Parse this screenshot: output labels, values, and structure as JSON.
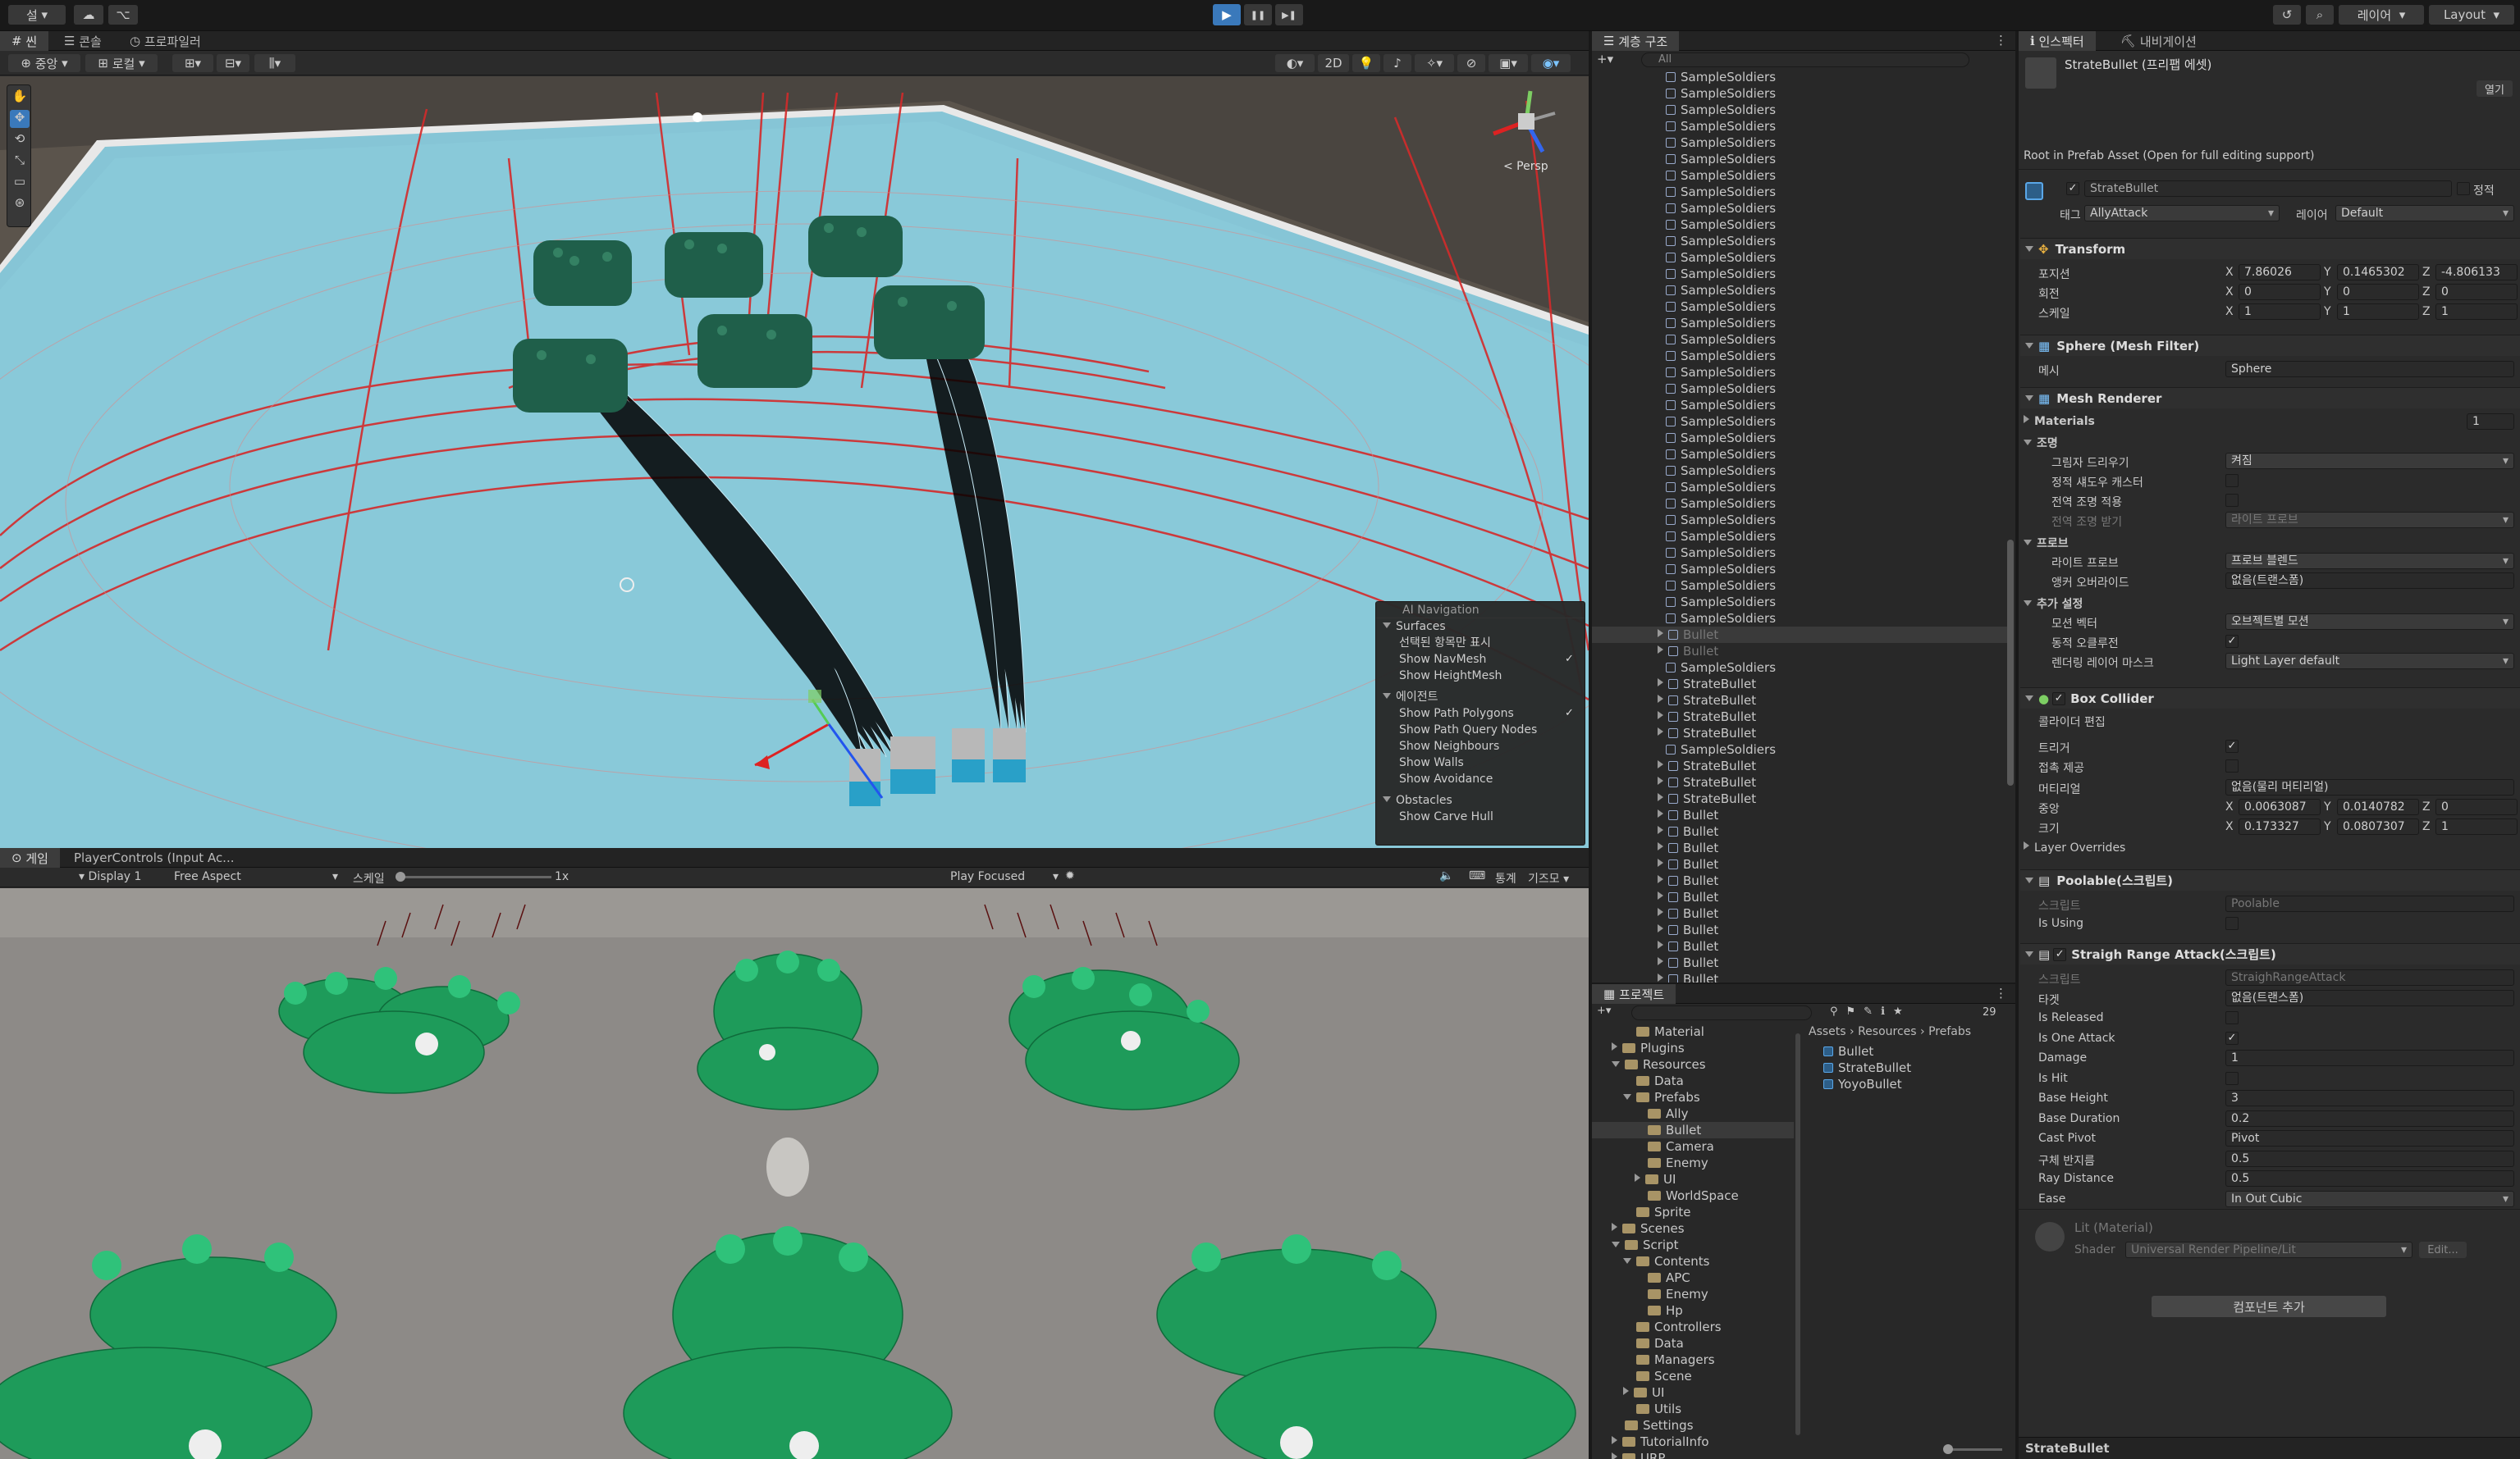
{
  "toolbar": {
    "account": "설",
    "play": "▶",
    "pause": "❚❚",
    "step": "▶❚",
    "layers": "레이어",
    "layout": "Layout"
  },
  "scene_tabs": [
    "씬",
    "콘솔",
    "프로파일러"
  ],
  "scene_toolbar": {
    "pivot": "중앙",
    "space": "로컬",
    "mode2d": "2D",
    "persp": "< Persp"
  },
  "nav_overlay": {
    "title": "AI Navigation",
    "surfaces": "Surfaces",
    "surfaces_items": [
      {
        "label": "선택된 항목만 표시",
        "checked": false
      },
      {
        "label": "Show NavMesh",
        "checked": true
      },
      {
        "label": "Show HeightMesh",
        "checked": false
      }
    ],
    "agents": "에이전트",
    "agents_items": [
      {
        "label": "Show Path Polygons",
        "checked": true
      },
      {
        "label": "Show Path Query Nodes",
        "checked": false
      },
      {
        "label": "Show Neighbours",
        "checked": false
      },
      {
        "label": "Show Walls",
        "checked": false
      },
      {
        "label": "Show Avoidance",
        "checked": false
      }
    ],
    "obstacles": "Obstacles",
    "obstacles_items": [
      {
        "label": "Show Carve Hull",
        "checked": false
      }
    ]
  },
  "game_view": {
    "tab": "게임",
    "tab2": "PlayerControls (Input Ac...",
    "display": "Display 1",
    "aspect": "Free Aspect",
    "scale_label": "스케일",
    "scale_value": "1x",
    "play_focused": "Play Focused",
    "stats": "통계",
    "gizmos": "기즈모"
  },
  "hierarchy": {
    "tab": "계층 구조",
    "search": "All",
    "rows": [
      "SampleSoldiers",
      "SampleSoldiers",
      "SampleSoldiers",
      "SampleSoldiers",
      "SampleSoldiers",
      "SampleSoldiers",
      "SampleSoldiers",
      "SampleSoldiers",
      "SampleSoldiers",
      "SampleSoldiers",
      "SampleSoldiers",
      "SampleSoldiers",
      "SampleSoldiers",
      "SampleSoldiers",
      "SampleSoldiers",
      "SampleSoldiers",
      "SampleSoldiers",
      "SampleSoldiers",
      "SampleSoldiers",
      "SampleSoldiers",
      "SampleSoldiers",
      "SampleSoldiers",
      "SampleSoldiers",
      "SampleSoldiers",
      "SampleSoldiers",
      "SampleSoldiers",
      "SampleSoldiers",
      "SampleSoldiers",
      "SampleSoldiers",
      "SampleSoldiers",
      "SampleSoldiers",
      "SampleSoldiers",
      "SampleSoldiers",
      "SampleSoldiers",
      "Bullet",
      "Bullet",
      "SampleSoldiers",
      "StrateBullet",
      "StrateBullet",
      "StrateBullet",
      "StrateBullet",
      "SampleSoldiers",
      "StrateBullet",
      "StrateBullet",
      "StrateBullet",
      "Bullet",
      "Bullet",
      "Bullet",
      "Bullet",
      "Bullet",
      "Bullet",
      "Bullet",
      "Bullet",
      "Bullet",
      "Bullet",
      "Bullet"
    ]
  },
  "project": {
    "tab": "프로젝트",
    "count": "29",
    "tree": [
      {
        "label": "Material",
        "indent": 2,
        "arrow": ""
      },
      {
        "label": "Plugins",
        "indent": 1,
        "arrow": "r"
      },
      {
        "label": "Resources",
        "indent": 1,
        "arrow": "d"
      },
      {
        "label": "Data",
        "indent": 2,
        "arrow": ""
      },
      {
        "label": "Prefabs",
        "indent": 2,
        "arrow": "d"
      },
      {
        "label": "Ally",
        "indent": 3,
        "arrow": ""
      },
      {
        "label": "Bullet",
        "indent": 3,
        "arrow": "",
        "selected": true
      },
      {
        "label": "Camera",
        "indent": 3,
        "arrow": ""
      },
      {
        "label": "Enemy",
        "indent": 3,
        "arrow": ""
      },
      {
        "label": "UI",
        "indent": 3,
        "arrow": "r"
      },
      {
        "label": "WorldSpace",
        "indent": 3,
        "arrow": ""
      },
      {
        "label": "Sprite",
        "indent": 2,
        "arrow": ""
      },
      {
        "label": "Scenes",
        "indent": 1,
        "arrow": "r"
      },
      {
        "label": "Script",
        "indent": 1,
        "arrow": "d"
      },
      {
        "label": "Contents",
        "indent": 2,
        "arrow": "d"
      },
      {
        "label": "APC",
        "indent": 3,
        "arrow": ""
      },
      {
        "label": "Enemy",
        "indent": 3,
        "arrow": ""
      },
      {
        "label": "Hp",
        "indent": 3,
        "arrow": ""
      },
      {
        "label": "Controllers",
        "indent": 2,
        "arrow": ""
      },
      {
        "label": "Data",
        "indent": 2,
        "arrow": ""
      },
      {
        "label": "Managers",
        "indent": 2,
        "arrow": ""
      },
      {
        "label": "Scene",
        "indent": 2,
        "arrow": ""
      },
      {
        "label": "UI",
        "indent": 2,
        "arrow": "r"
      },
      {
        "label": "Utils",
        "indent": 2,
        "arrow": ""
      },
      {
        "label": "Settings",
        "indent": 1,
        "arrow": ""
      },
      {
        "label": "TutorialInfo",
        "indent": 1,
        "arrow": "r"
      },
      {
        "label": "URP",
        "indent": 1,
        "arrow": "r"
      }
    ],
    "breadcrumb": [
      "Assets",
      "Resources",
      "Prefabs"
    ],
    "files": [
      "Bullet",
      "StrateBullet",
      "YoyoBullet"
    ]
  },
  "inspector": {
    "tabs": [
      "인스펙터",
      "내비게이션"
    ],
    "asset_title": "StrateBullet (프리팹 에셋)",
    "open_btn": "열기",
    "root_note": "Root in Prefab Asset (Open for full editing support)",
    "name": "StrateBullet",
    "static": "정적",
    "tag_label": "태그",
    "tag": "AllyAttack",
    "layer_label": "레이어",
    "layer": "Default",
    "transform": {
      "title": "Transform",
      "pos_label": "포지션",
      "rot_label": "회전",
      "scale_label": "스케일",
      "pos": [
        "7.86026",
        "0.1465302",
        "-4.806133"
      ],
      "rot": [
        "0",
        "0",
        "0"
      ],
      "scale": [
        "1",
        "1",
        "1"
      ]
    },
    "mesh_filter": {
      "title": "Sphere (Mesh Filter)",
      "mesh_label": "메시",
      "mesh": "Sphere"
    },
    "mesh_renderer": {
      "title": "Mesh Renderer",
      "materials": "Materials",
      "materials_count": "1",
      "lighting": "조명",
      "cast_shadows_label": "그림자 드리우기",
      "cast_shadows": "켜짐",
      "static_shadow": "정적 섀도우 캐스터",
      "gi_contrib": "전역 조명 적용",
      "gi_receive": "전역 조명 받기",
      "gi_receive_val": "라이트 프로브",
      "probes": "프로브",
      "light_probes_label": "라이트 프로브",
      "light_probes": "프로브 블렌드",
      "anchor_label": "앵커 오버라이드",
      "anchor": "없음(트랜스폼)",
      "additional": "추가 설정",
      "motion_label": "모션 벡터",
      "motion": "오브젝트별 모션",
      "occlusion_label": "동적 오클루전",
      "layer_mask_label": "렌더링 레이어 마스크",
      "layer_mask": "Light Layer default"
    },
    "box_collider": {
      "title": "Box Collider",
      "edit_label": "콜라이더 편집",
      "trigger_label": "트리거",
      "contact_label": "접촉 제공",
      "material_label": "머티리얼",
      "material": "없음(물리 머티리얼)",
      "center_label": "중앙",
      "center": [
        "0.0063087",
        "0.0140782",
        "0"
      ],
      "size_label": "크기",
      "size": [
        "0.173327",
        "0.0807307",
        "1"
      ],
      "overrides": "Layer Overrides"
    },
    "poolable": {
      "title": "Poolable(스크립트)",
      "script_label": "스크립트",
      "script": "Poolable",
      "using_label": "Is Using"
    },
    "straight": {
      "title": "Straigh Range Attack(스크립트)",
      "script_label": "스크립트",
      "script": "StraighRangeAttack",
      "target_label": "타겟",
      "target": "없음(트랜스폼)",
      "released_label": "Is Released",
      "one_attack_label": "Is One Attack",
      "damage_label": "Damage",
      "damage": "1",
      "hit_label": "Is Hit",
      "height_label": "Base Height",
      "height": "3",
      "duration_label": "Base Duration",
      "duration": "0.2",
      "pivot_label": "Cast Pivot",
      "pivot": "Pivot",
      "radius_label": "구체 반지름",
      "radius": "0.5",
      "ray_label": "Ray Distance",
      "ray": "0.5",
      "ease_label": "Ease",
      "ease": "In Out Cubic"
    },
    "material": {
      "title": "Lit (Material)",
      "shader_label": "Shader",
      "shader": "Universal Render Pipeline/Lit",
      "edit": "Edit..."
    },
    "add_component": "컴포넌트 추가",
    "footer": "StrateBullet"
  },
  "colors": {
    "accent": "#3a79bb",
    "navmesh": "#7fd0e0",
    "path": "#d02020",
    "soldier": "#1e9b5a"
  }
}
